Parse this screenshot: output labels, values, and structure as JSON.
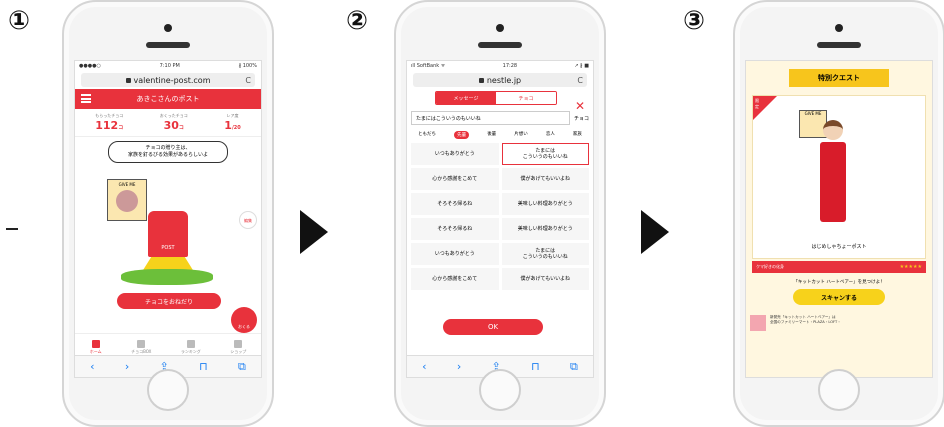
{
  "steps": {
    "one": "①",
    "two": "②",
    "three": "③"
  },
  "phone1": {
    "status": {
      "carrier": "●●●●○",
      "time": "7:10 PM",
      "battery": "∦ 100%"
    },
    "url": "valentine-post.com",
    "reload": "C",
    "header_title": "あきこさんのポスト",
    "stats": [
      {
        "label": "もらったチョコ",
        "value": "112",
        "unit": "コ"
      },
      {
        "label": "おくったチョコ",
        "value": "30",
        "unit": "コ"
      },
      {
        "label": "レア度",
        "value": "1",
        "unit": "/20"
      }
    ],
    "bubble": "チョコの贈り主は、\n家族を釘るびる効果があるらしいよ",
    "sign_text": "GIVE ME",
    "post_label": "POST",
    "edit_label": "編集",
    "choco_button": "チョコをおねだり",
    "fab_label": "おくる",
    "tabs": [
      {
        "label": "ホーム"
      },
      {
        "label": "チョコBOX"
      },
      {
        "label": "ランキング"
      },
      {
        "label": "ショップ"
      }
    ],
    "safari": {
      "back": "‹",
      "forward": "›",
      "share": "⇪",
      "bookmarks": "⊓",
      "tabs": "⧉"
    }
  },
  "phone2": {
    "status": {
      "carrier": "ıll SoftBank ᯤ",
      "time": "17:28",
      "battery": "↗ ∦ ■"
    },
    "url": "nestle.jp",
    "reload": "C",
    "segments": {
      "left": "メッセージ",
      "right": "チョコ"
    },
    "close": "✕",
    "message_value": "たまにはこういうのもいいね",
    "message_suffix": "チョコ",
    "categories": [
      "ともだち",
      "先輩",
      "後輩",
      "片想い",
      "恋人",
      "家族"
    ],
    "selected_category": "先輩",
    "messages": [
      "いつもありがとう",
      "たまには\nこういうのもいいね",
      "心から感謝をこめて",
      "僕があげてもいいよね",
      "そろそろ帰るね",
      "美味しい料理ありがとう",
      "そろそろ帰るね",
      "美味しい料理ありがとう",
      "いつもありがとう",
      "たまには\nこういうのもいいね",
      "心から感謝をこめて",
      "僕があげてもいいよね"
    ],
    "ok_button": "OK"
  },
  "phone3": {
    "banner": "特別クエスト",
    "ribbon": "限定",
    "sign_text": "GIVE ME",
    "card_name": "はじめしゃちょーポスト",
    "rarity_label": "クマ好きの化身",
    "stars": "★★★★★",
    "mission": "「キットカット ハートベアー」を見つけよ！",
    "scan_button": "スキャンする",
    "news": "新発売「キットカット ハートベアー」は\n全国のファミリーマート・PLAZA・LOFT・"
  }
}
